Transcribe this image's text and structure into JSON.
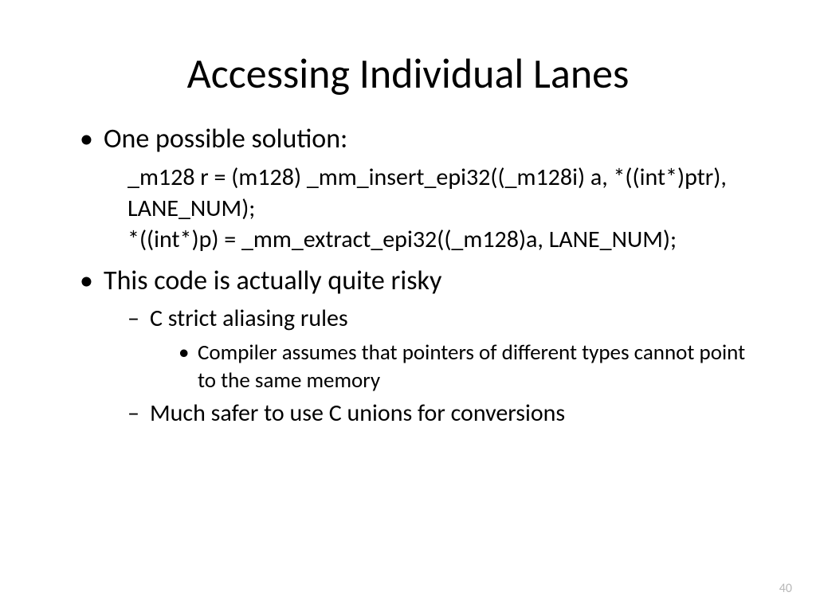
{
  "slide": {
    "title": "Accessing Individual Lanes",
    "bullet1": "One possible solution:",
    "code_line1": "_m128 r = (m128) _mm_insert_epi32((_m128i) a, *((int*)ptr), LANE_NUM);",
    "code_line2": "*((int*)p) = _mm_extract_epi32((_m128)a, LANE_NUM);",
    "bullet2": "This code is actually quite risky",
    "sub1": "C strict aliasing rules",
    "subsub1": "Compiler assumes that pointers of different types cannot point to the same memory",
    "sub2": "Much safer to use C unions for conversions",
    "page_number": "40"
  }
}
